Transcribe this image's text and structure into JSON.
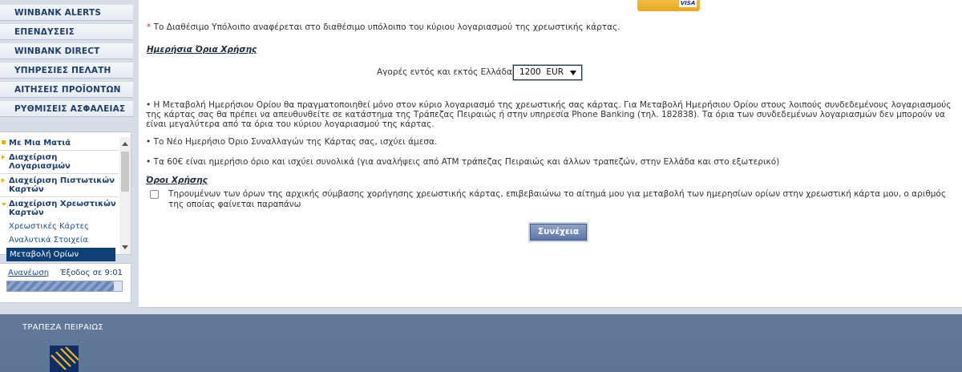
{
  "menu": {
    "items": [
      "WINBANK ALERTS",
      "ΕΠΕΝΔΥΣΕΙΣ",
      "WINBANK DIRECT",
      "ΥΠΗΡΕΣΙΕΣ ΠΕΛΑΤΗ",
      "ΑΙΤΗΣΕΙΣ ΠΡΟΪΟΝΤΩΝ",
      "ΡΥΘΜΙΣΕΙΣ ΑΣΦΑΛΕΙΑΣ"
    ]
  },
  "nav": {
    "overview": "Με Μια Ματιά",
    "accounts": "Διαχείριση Λογαριασμών",
    "credit_cards": "Διαχείριση Πιστωτικών Καρτών",
    "debit_cards": "Διαχείριση Χρεωστικών Καρτών",
    "sub_items": [
      "Χρεωστικές Κάρτες",
      "Αναλυτικά Στοιχεία",
      "Μεταβολή Ορίων"
    ]
  },
  "session": {
    "refresh_label": "Ανανέωση",
    "logout_label": "Έξοδος σε",
    "logout_time": "9:01",
    "progress_fraction": 0.93
  },
  "card": {
    "brand": "VISA"
  },
  "content": {
    "note_star": "*",
    "note": "Το Διαθέσιμο Υπόλοιπο αναφέρεται στο διαθέσιμο υπόλοιπο του κύριου λογαριασμού της χρεωστικής κάρτας.",
    "limits_title": "Ημερήσια Όρια Χρήσης",
    "limit_label": "Αγορές εντός και εκτός Ελλάδας:",
    "limit_value": "1200  EUR",
    "bullets": [
      "• Η Μεταβολή Ημερήσιου Ορίου θα πραγματοποιηθεί μόνο στον κύριο λογαριασμό της χρεωστικής σας κάρτας. Για Μεταβολή Ημερήσιου Ορίου στους λοιπούς συνδεδεμένους λογαριασμούς της κάρτας σας θα πρέπει να απευθυνθείτε σε κατάστημα της Τράπεζας Πειραιώς ή στην υπηρεσία Phone Banking (τηλ. 182838). Τα όρια των συνδεδεμένων λογαριασμών δεν μπορούν να είναι μεγαλύτερα από τα όρια του κύριου λογαριασμού της κάρτας.",
      "• Το Νέο Ημερήσιο Όριο Συναλλαγών της Κάρτας σας, ισχύει άμεσα.",
      "• Τα 60€ είναι ημερήσιο όριο και ισχύει συνολικά (για αναλήψεις από ATM τράπεζας Πειραιώς και άλλων τραπεζών, στην Ελλάδα και στο εξωτερικό)"
    ],
    "terms_title": "Όροι Χρήσης",
    "terms_text": "Τηρουμένων των όρων της αρχικής σύμβασης χορήγησης χρεωστικής κάρτας, επιβεβαιώνω το αίτημά μου για μεταβολή των ημερησίων ορίων στην χρεωστική κάρτα μου, ο αριθμός της οποίας φαίνεται παραπάνω",
    "continue_label": "Συνέχεια"
  },
  "footer": {
    "brand": "ΤΡΑΠΕΖΑ ΠΕΙΡΑΙΩΣ"
  },
  "colors": {
    "navy": "#1d3e6d",
    "accent_gold": "#e2b51a",
    "active_item": "#0e3f75",
    "footer_bg": "#62799a"
  }
}
